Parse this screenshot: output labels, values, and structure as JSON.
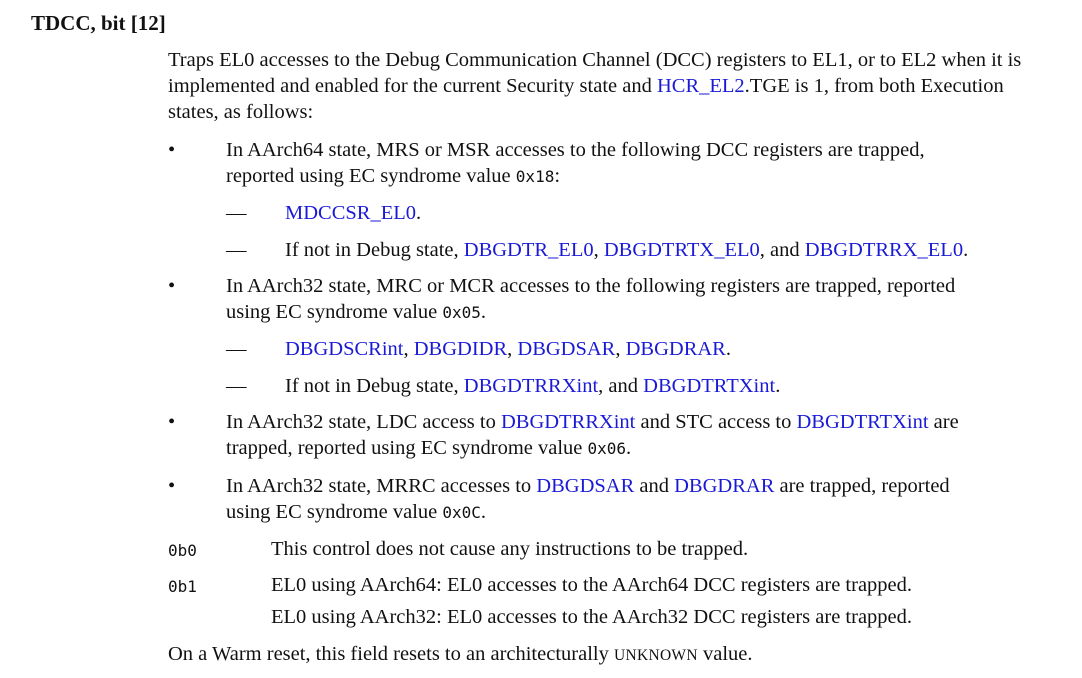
{
  "heading": "TDCC, bit [12]",
  "intro": {
    "before_link": "Traps EL0 accesses to the Debug Communication Channel (DCC) registers to EL1, or to EL2 when it is implemented and enabled for the current Security state and ",
    "link": "HCR_EL2",
    "after_link": ".TGE is 1, from both Execution states, as follows:"
  },
  "bullet_glyph": "•",
  "dash_glyph": "—",
  "bullets": [
    {
      "line1": "In AArch64 state, MRS or MSR accesses to the following DCC registers are trapped,",
      "line2_text": "reported using EC syndrome value ",
      "code": "0x18",
      "suffix": ":",
      "subs": [
        {
          "link1": "MDCCSR_EL0",
          "end": "."
        },
        {
          "prefix": "If not in Debug state, ",
          "link1": "DBGDTR_EL0",
          "sep1": ", ",
          "link2": "DBGDTRTX_EL0",
          "sep2": ", and ",
          "link3": "DBGDTRRX_EL0",
          "end": "."
        }
      ]
    },
    {
      "line1": "In AArch32 state, MRC or MCR accesses to the following registers are trapped, reported",
      "line2_text": "using EC syndrome value ",
      "code": "0x05",
      "suffix": ".",
      "subs": [
        {
          "link1": "DBGDSCRint",
          "sep1": ", ",
          "link2": "DBGDIDR",
          "sep2": ", ",
          "link3": "DBGDSAR",
          "sep3": ", ",
          "link4": "DBGDRAR",
          "end": "."
        },
        {
          "prefix": "If not in Debug state, ",
          "link1": "DBGDTRRXint",
          "sep1": ", and ",
          "link2": "DBGDTRTXint",
          "end": "."
        }
      ]
    },
    {
      "line1_a": "In AArch32 state, LDC access to ",
      "link1": "DBGDTRRXint",
      "line1_b": " and STC access to ",
      "link2": "DBGDTRTXint",
      "line1_c": " are",
      "line2_text": "trapped, reported using EC syndrome value ",
      "code": "0x06",
      "suffix": "."
    },
    {
      "line1_a": "In AArch32 state, MRRC accesses to ",
      "link1": "DBGDSAR",
      "line1_b": " and ",
      "link2": "DBGDRAR",
      "line1_c": " are trapped, reported",
      "line2_text": "using EC syndrome value ",
      "code": "0x0C",
      "suffix": "."
    }
  ],
  "values": [
    {
      "code": "0b0",
      "lines": [
        "This control does not cause any instructions to be trapped."
      ]
    },
    {
      "code": "0b1",
      "lines": [
        "EL0 using AArch64: EL0 accesses to the AArch64 DCC registers are trapped.",
        "EL0 using AArch32: EL0 accesses to the AArch32 DCC registers are trapped."
      ]
    }
  ],
  "reset": {
    "before": "On a Warm reset, this field resets to an architecturally ",
    "smallcaps": "UNKNOWN",
    "after": " value."
  },
  "colors": {
    "link": "#1a1ad6",
    "text": "#111111"
  }
}
